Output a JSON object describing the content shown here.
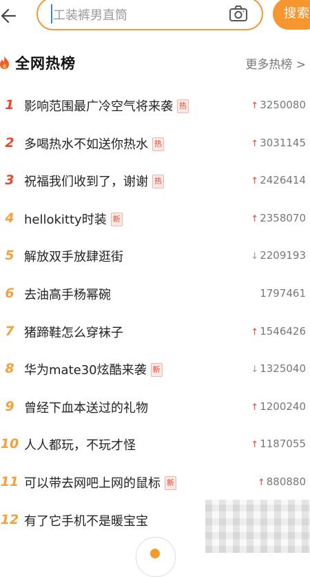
{
  "search": {
    "placeholder": "工装裤男直筒",
    "button_label": "搜索"
  },
  "section": {
    "title": "全网热榜",
    "more_label": "更多热榜 >"
  },
  "list": [
    {
      "rank": "1",
      "title": "影响范围最广冷空气将来袭",
      "tag": "热",
      "trend": "up",
      "count": "3250080"
    },
    {
      "rank": "2",
      "title": "多喝热水不如送你热水",
      "tag": "热",
      "trend": "up",
      "count": "3031145"
    },
    {
      "rank": "3",
      "title": "祝福我们收到了，谢谢",
      "tag": "热",
      "trend": "up",
      "count": "2426414"
    },
    {
      "rank": "4",
      "title": "hellokitty时装",
      "tag": "新",
      "trend": "up",
      "count": "2358070"
    },
    {
      "rank": "5",
      "title": "解放双手放肆逛街",
      "tag": "",
      "trend": "down",
      "count": "2209193"
    },
    {
      "rank": "6",
      "title": "去油高手杨幂碗",
      "tag": "",
      "trend": "none",
      "count": "1797461"
    },
    {
      "rank": "7",
      "title": "猪蹄鞋怎么穿袜子",
      "tag": "",
      "trend": "up",
      "count": "1546426"
    },
    {
      "rank": "8",
      "title": "华为mate30炫酷来袭",
      "tag": "新",
      "trend": "down",
      "count": "1325040"
    },
    {
      "rank": "9",
      "title": "曾经下血本送过的礼物",
      "tag": "",
      "trend": "up",
      "count": "1200240"
    },
    {
      "rank": "10",
      "title": "人人都玩，不玩才怪",
      "tag": "",
      "trend": "up",
      "count": "1187055"
    },
    {
      "rank": "11",
      "title": "可以带去网吧上网的鼠标",
      "tag": "新",
      "trend": "up",
      "count": "880880"
    },
    {
      "rank": "12",
      "title": "有了它手机不是暖宝宝",
      "tag": "",
      "trend": "none",
      "count": ""
    }
  ],
  "colors": {
    "accent": "#f7962e",
    "rank_top": "#e8472f",
    "rank_rest": "#f4a13a",
    "tag_text": "#e8472f",
    "trend_up": "#e8472f",
    "trend_down": "#9a9a9a"
  },
  "icons": {
    "back": "arrow-left-icon",
    "camera": "camera-icon",
    "section": "fire-icon"
  }
}
